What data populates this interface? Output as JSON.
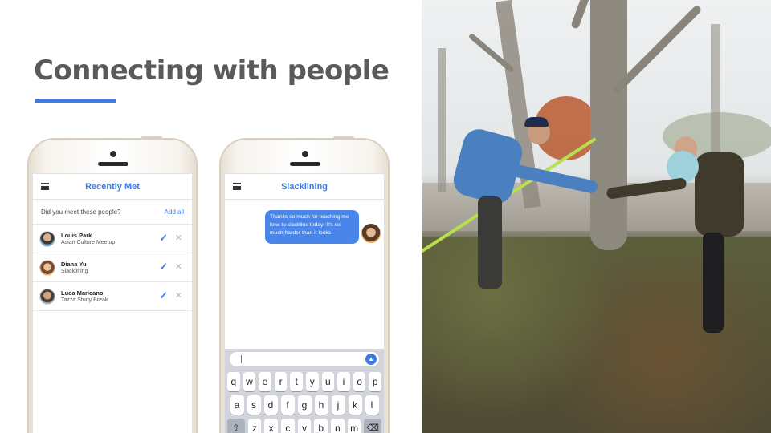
{
  "slide": {
    "title": "Connecting with people",
    "accent_color": "#3f7be3"
  },
  "phone_recently_met": {
    "header_title": "Recently Met",
    "menu_icon": "hamburger-menu-icon",
    "prompt": "Did you meet these people?",
    "add_all_label": "Add all",
    "people": [
      {
        "name": "Louis Park",
        "context": "Asian Culture Meetup"
      },
      {
        "name": "Diana Yu",
        "context": "Slacklining"
      },
      {
        "name": "Luca Maricano",
        "context": "Tazza Study Break"
      }
    ],
    "confirm_icon": "checkmark-icon",
    "dismiss_icon": "close-icon"
  },
  "phone_chat": {
    "header_title": "Slacklining",
    "message": "Thanks so much for teaching me how to slackline today! It's so much harder than it looks!",
    "send_icon": "send-arrow-icon",
    "keyboard_rows": [
      [
        "q",
        "w",
        "e",
        "r",
        "t",
        "y",
        "u",
        "i",
        "o",
        "p"
      ],
      [
        "a",
        "s",
        "d",
        "f",
        "g",
        "h",
        "j",
        "k",
        "l"
      ],
      [
        "⇧",
        "z",
        "x",
        "c",
        "v",
        "b",
        "n",
        "m",
        "⌫"
      ]
    ]
  },
  "photo": {
    "subject": "slackline-handshake-photo"
  }
}
